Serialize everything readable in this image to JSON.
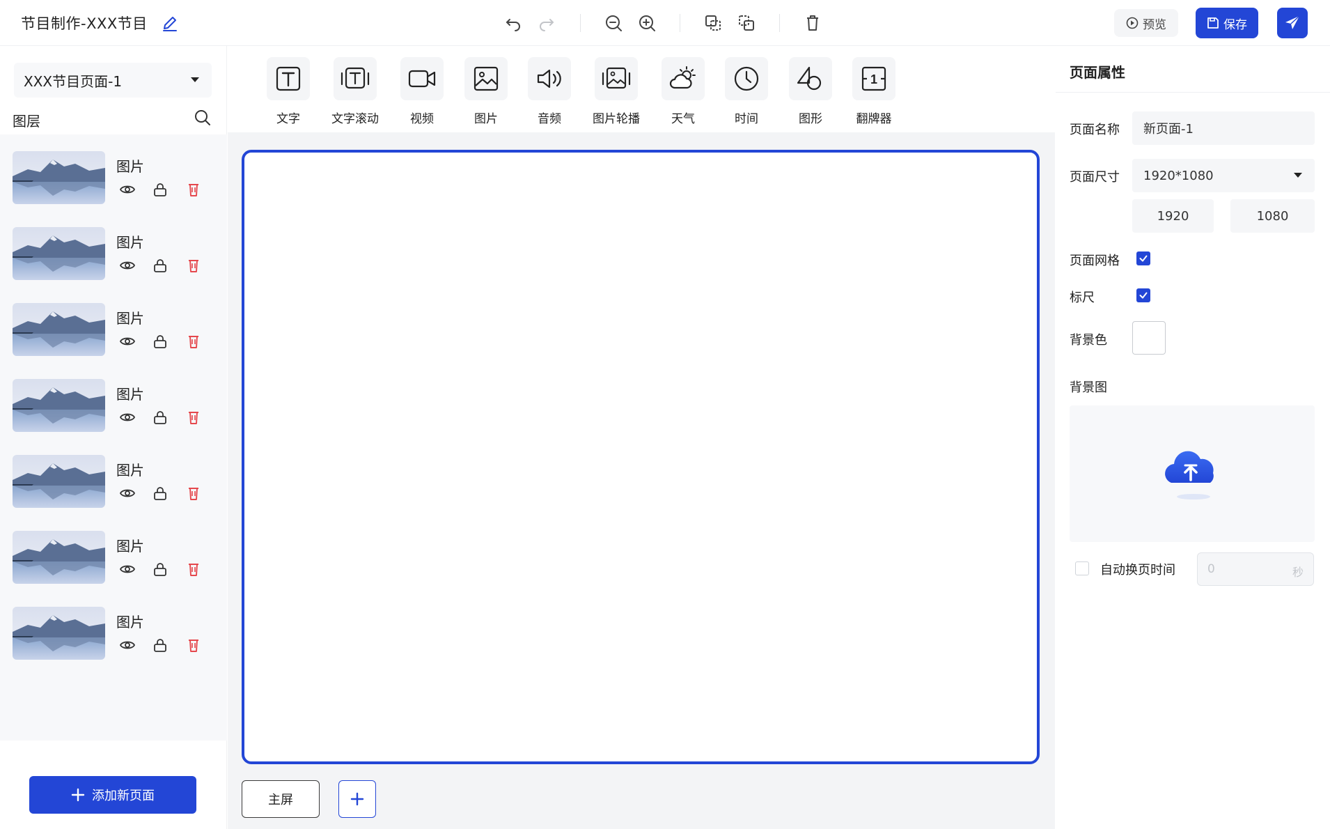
{
  "header": {
    "title": "节目制作-XXX节目",
    "preview_label": "预览",
    "save_label": "保存"
  },
  "left": {
    "page_select_value": "XXX节目页面-1",
    "layers_title": "图层",
    "layers": [
      {
        "name": "图片"
      },
      {
        "name": "图片"
      },
      {
        "name": "图片"
      },
      {
        "name": "图片"
      },
      {
        "name": "图片"
      },
      {
        "name": "图片"
      },
      {
        "name": "图片"
      }
    ],
    "add_page_label": "添加新页面"
  },
  "tools": [
    {
      "label": "文字",
      "icon": "text-icon"
    },
    {
      "label": "文字滚动",
      "icon": "text-scroll-icon"
    },
    {
      "label": "视频",
      "icon": "video-icon"
    },
    {
      "label": "图片",
      "icon": "image-icon"
    },
    {
      "label": "音频",
      "icon": "audio-icon"
    },
    {
      "label": "图片轮播",
      "icon": "carousel-icon"
    },
    {
      "label": "天气",
      "icon": "weather-icon"
    },
    {
      "label": "时间",
      "icon": "clock-icon"
    },
    {
      "label": "图形",
      "icon": "shape-icon"
    },
    {
      "label": "翻牌器",
      "icon": "flip-counter-icon"
    }
  ],
  "flip_counter_digit": "1",
  "screens": {
    "main_label": "主屏"
  },
  "properties": {
    "title": "页面属性",
    "page_name_label": "页面名称",
    "page_name_value": "新页面-1",
    "page_size_label": "页面尺寸",
    "page_size_value": "1920*1080",
    "width_value": "1920",
    "height_value": "1080",
    "grid_label": "页面网格",
    "grid_checked": true,
    "ruler_label": "标尺",
    "ruler_checked": true,
    "bg_color_label": "背景色",
    "bg_color_value": "#ffffff",
    "bg_image_label": "背景图",
    "auto_switch_label": "自动换页时间",
    "auto_switch_checked": false,
    "auto_switch_value": "0",
    "auto_switch_unit": "秒"
  },
  "colors": {
    "accent": "#2346d6",
    "danger": "#e5484d"
  }
}
